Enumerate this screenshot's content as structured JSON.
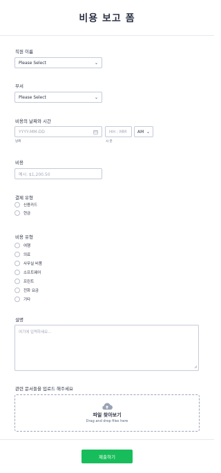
{
  "header": {
    "title": "비용 보고 폼"
  },
  "employee": {
    "label": "직원 이름",
    "value": "Please Select"
  },
  "department": {
    "label": "부서",
    "value": "Please Select"
  },
  "datetime": {
    "label": "비용의 날짜와 시간",
    "date_placeholder": "YYYY-MM-DD",
    "date_sublabel": "날짜",
    "time_placeholder": "HH : MM",
    "time_sublabel": "시 분",
    "ampm": "AM"
  },
  "cost": {
    "label": "비용",
    "placeholder": "예시: $1,200.50"
  },
  "payment": {
    "label": "결제 유형",
    "options": [
      "신용카드",
      "현금"
    ]
  },
  "expense_type": {
    "label": "비용 유형",
    "options": [
      "여행",
      "의료",
      "사무실 비품",
      "소프트웨어",
      "프린트",
      "전화 요금",
      "기타"
    ]
  },
  "description": {
    "label": "설명",
    "placeholder": "여기에 입력하세요..."
  },
  "upload": {
    "label": "관련 문서들을 업로드 해주세요",
    "title": "파일 찾아보기",
    "subtitle": "Drag and drop files here"
  },
  "submit": {
    "label": "제출하기"
  },
  "colors": {
    "accent": "#18bd5b",
    "border": "#c3cad8",
    "text": "#2c3345"
  },
  "icons": {
    "chevron": "chevron-down-icon",
    "calendar": "calendar-icon",
    "upload": "cloud-upload-icon",
    "resize": "resize-handle-icon"
  }
}
